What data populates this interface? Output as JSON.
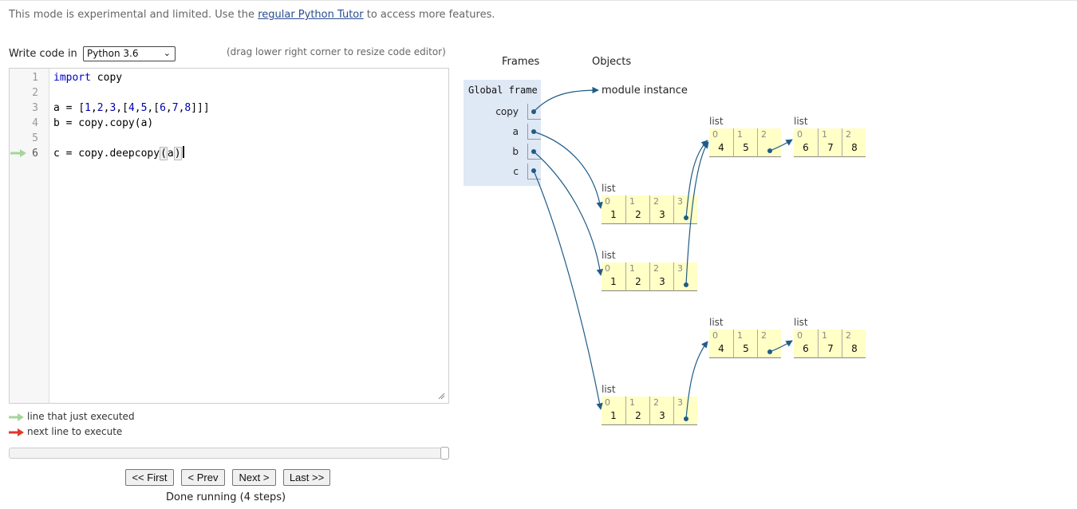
{
  "banner": {
    "prefix": "This mode is experimental and limited. Use the ",
    "link": "regular Python Tutor",
    "suffix": " to access more features."
  },
  "editor_header": {
    "write_label": "Write code in",
    "language": "Python 3.6",
    "drag_hint": "(drag lower right corner to resize code editor)"
  },
  "code_lines": [
    {
      "n": "1",
      "text": "import copy"
    },
    {
      "n": "2",
      "text": ""
    },
    {
      "n": "3",
      "text": "a = [1,2,3,[4,5,[6,7,8]]]"
    },
    {
      "n": "4",
      "text": "b = copy.copy(a)"
    },
    {
      "n": "5",
      "text": ""
    },
    {
      "n": "6",
      "text": "c = copy.deepcopy(a)"
    }
  ],
  "current_line": "6",
  "legend": {
    "executed": "line that just executed",
    "next": "next line to execute"
  },
  "nav": {
    "first": "<< First",
    "prev": "< Prev",
    "next": "Next >",
    "last": "Last >>"
  },
  "status": "Done running (4 steps)",
  "viz": {
    "frames_header": "Frames",
    "objects_header": "Objects",
    "global_frame": "Global frame",
    "variables": [
      "copy",
      "a",
      "b",
      "c"
    ],
    "module_label": "module instance",
    "list_label": "list",
    "lists": {
      "outer_a": {
        "idx": [
          "0",
          "1",
          "2",
          "3"
        ],
        "vals": [
          "1",
          "2",
          "3",
          ""
        ]
      },
      "outer_b": {
        "idx": [
          "0",
          "1",
          "2",
          "3"
        ],
        "vals": [
          "1",
          "2",
          "3",
          ""
        ]
      },
      "outer_c": {
        "idx": [
          "0",
          "1",
          "2",
          "3"
        ],
        "vals": [
          "1",
          "2",
          "3",
          ""
        ]
      },
      "mid_shared": {
        "idx": [
          "0",
          "1",
          "2"
        ],
        "vals": [
          "4",
          "5",
          ""
        ]
      },
      "inner_shared": {
        "idx": [
          "0",
          "1",
          "2"
        ],
        "vals": [
          "6",
          "7",
          "8"
        ]
      },
      "mid_deep": {
        "idx": [
          "0",
          "1",
          "2"
        ],
        "vals": [
          "4",
          "5",
          ""
        ]
      },
      "inner_deep": {
        "idx": [
          "0",
          "1",
          "2"
        ],
        "vals": [
          "6",
          "7",
          "8"
        ]
      }
    }
  },
  "colors": {
    "arrow": "#1f5c86",
    "list_bg": "#ffffc6",
    "frame_bg": "#dfe8f5",
    "green_arrow": "#a6d59b",
    "red_arrow": "#e0392b"
  }
}
